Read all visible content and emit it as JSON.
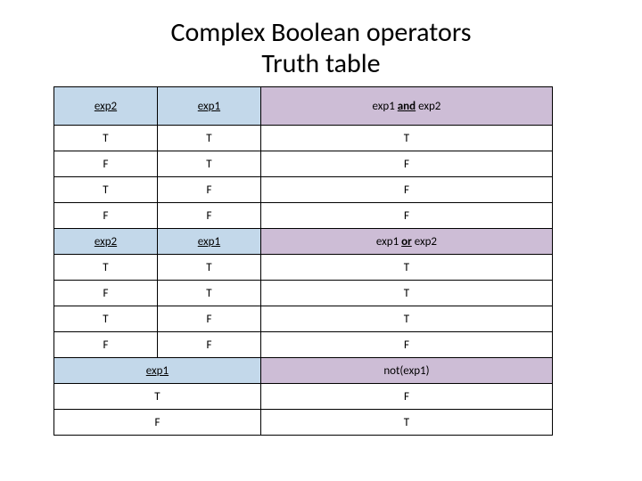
{
  "title_line1": "Complex Boolean operators",
  "title_line2": "Truth table",
  "and": {
    "h_exp2": "exp2",
    "h_exp1": "exp1",
    "h_res_pre": "exp1 ",
    "h_res_op": "and",
    "h_res_post": " exp2",
    "rows": [
      {
        "exp2": "T",
        "exp1": "T",
        "res": "T"
      },
      {
        "exp2": "F",
        "exp1": "T",
        "res": "F"
      },
      {
        "exp2": "T",
        "exp1": "F",
        "res": "F"
      },
      {
        "exp2": "F",
        "exp1": "F",
        "res": "F"
      }
    ]
  },
  "or": {
    "h_exp2": "exp2",
    "h_exp1": "exp1",
    "h_res_pre": "exp1 ",
    "h_res_op": "or",
    "h_res_post": " exp2",
    "rows": [
      {
        "exp2": "T",
        "exp1": "T",
        "res": "T"
      },
      {
        "exp2": "F",
        "exp1": "T",
        "res": "T"
      },
      {
        "exp2": "T",
        "exp1": "F",
        "res": "T"
      },
      {
        "exp2": "F",
        "exp1": "F",
        "res": "F"
      }
    ]
  },
  "not": {
    "h_exp1": "exp1",
    "h_res": "not(exp1)",
    "rows": [
      {
        "exp1": "T",
        "res": "F"
      },
      {
        "exp1": "F",
        "res": "T"
      }
    ]
  }
}
